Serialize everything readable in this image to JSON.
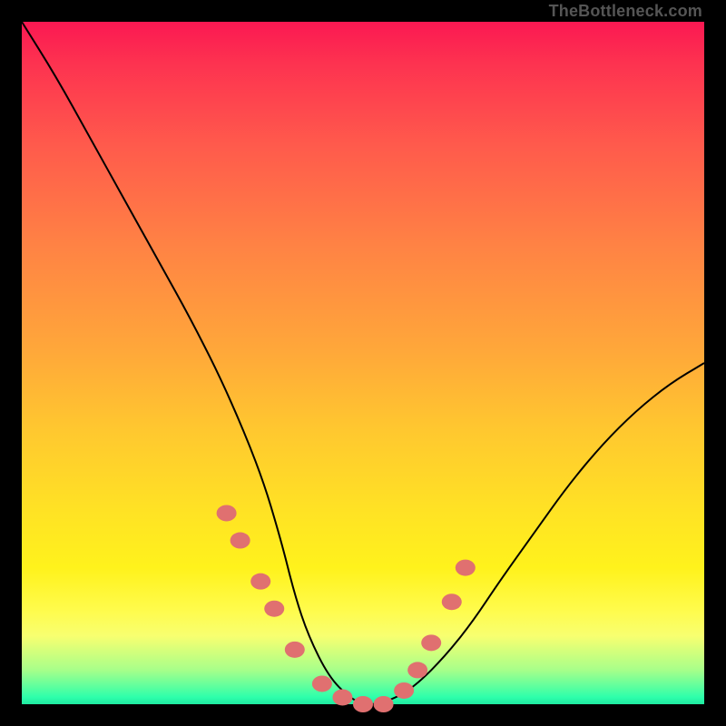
{
  "attribution": "TheBottleneck.com",
  "colors": {
    "frame": "#000000",
    "gradient_top": "#fb1852",
    "gradient_bottom": "#1fe9a0",
    "curve": "#000000",
    "dots": "#e07070"
  },
  "chart_data": {
    "type": "line",
    "title": "",
    "xlabel": "",
    "ylabel": "",
    "xlim": [
      0,
      100
    ],
    "ylim": [
      0,
      100
    ],
    "series": [
      {
        "name": "bottleneck-curve",
        "x": [
          0,
          5,
          10,
          15,
          20,
          25,
          30,
          35,
          38,
          40,
          42,
          45,
          48,
          50,
          52,
          55,
          58,
          62,
          66,
          70,
          75,
          80,
          85,
          90,
          95,
          100
        ],
        "y": [
          100,
          92,
          83,
          74,
          65,
          56,
          46,
          34,
          24,
          16,
          10,
          4,
          1,
          0,
          0,
          1,
          3,
          7,
          12,
          18,
          25,
          32,
          38,
          43,
          47,
          50
        ]
      }
    ],
    "markers": {
      "name": "highlighted-points",
      "x": [
        30,
        32,
        35,
        37,
        40,
        44,
        47,
        50,
        53,
        56,
        58,
        60,
        63,
        65
      ],
      "y": [
        28,
        24,
        18,
        14,
        8,
        3,
        1,
        0,
        0,
        2,
        5,
        9,
        15,
        20
      ]
    }
  }
}
